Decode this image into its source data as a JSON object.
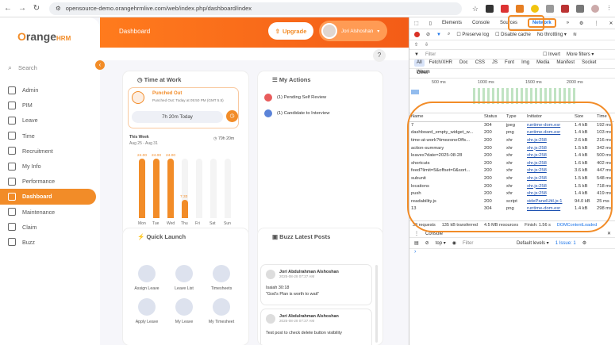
{
  "browser": {
    "url": "opensource-demo.orangehrmlive.com/web/index.php/dashboard/index"
  },
  "app": {
    "logo": "OrangeHRM",
    "search_placeholder": "Search",
    "page_title": "Dashboard",
    "upgrade_label": "Upgrade",
    "user_name": "Jori Alshoshan",
    "help_label": "?",
    "menu": [
      {
        "label": "Admin",
        "icon": "admin-icon"
      },
      {
        "label": "PIM",
        "icon": "pim-icon"
      },
      {
        "label": "Leave",
        "icon": "leave-icon"
      },
      {
        "label": "Time",
        "icon": "time-icon"
      },
      {
        "label": "Recruitment",
        "icon": "recruitment-icon"
      },
      {
        "label": "My Info",
        "icon": "myinfo-icon"
      },
      {
        "label": "Performance",
        "icon": "performance-icon"
      },
      {
        "label": "Dashboard",
        "icon": "dashboard-icon",
        "active": true
      },
      {
        "label": "Maintenance",
        "icon": "maintenance-icon"
      },
      {
        "label": "Claim",
        "icon": "claim-icon"
      },
      {
        "label": "Buzz",
        "icon": "buzz-icon"
      }
    ],
    "time_at_work": {
      "title": "Time at Work",
      "status": "Punched Out",
      "punched_out": "Punched Out: Today at 05:50 PM (GMT 5.5)",
      "today": "7h 20m Today",
      "week_label": "This Week",
      "week_range": "Aug 25 - Aug 31",
      "week_total": "79h 20m",
      "bars": [
        {
          "day": "Mon",
          "value": 24.0,
          "label": "24.00"
        },
        {
          "day": "Tue",
          "value": 24.0,
          "label": "24.00"
        },
        {
          "day": "Wed",
          "value": 24.0,
          "label": "24.00"
        },
        {
          "day": "Thu",
          "value": 7.33,
          "label": "7.33"
        },
        {
          "day": "Fri",
          "value": 0,
          "label": ""
        },
        {
          "day": "Sat",
          "value": 0,
          "label": ""
        },
        {
          "day": "Sun",
          "value": 0,
          "label": ""
        }
      ]
    },
    "my_actions": {
      "title": "My Actions",
      "items": [
        "(1) Pending Self Review",
        "(1) Candidate to Interview"
      ]
    },
    "quick_launch": {
      "title": "Quick Launch",
      "items": [
        "Assign Leave",
        "Leave List",
        "Timesheets",
        "Apply Leave",
        "My Leave",
        "My Timesheet"
      ]
    },
    "buzz": {
      "title": "Buzz Latest Posts",
      "posts": [
        {
          "author": "Jori Abdulrahman Alshoshan",
          "date": "2025-08-28 07:37 AM",
          "text": "Isaiah 30:18\n\"God's Plan is worth to wait\""
        },
        {
          "author": "Jori Abdulrahman Alshoshan",
          "date": "2025-08-28 07:37 AM",
          "text": "Test post to check delete button visibility"
        }
      ]
    }
  },
  "devtools": {
    "tabs": [
      "Elements",
      "Console",
      "Sources",
      "Network"
    ],
    "active_tab": "Network",
    "preserve_log": "Preserve log",
    "disable_cache": "Disable cache",
    "throttle": "No throttling",
    "filter_placeholder": "Filter",
    "invert": "Invert",
    "more_filters": "More filters",
    "types": [
      "All",
      "Fetch/XHR",
      "Doc",
      "CSS",
      "JS",
      "Font",
      "Img",
      "Media",
      "Manifest",
      "Socket",
      "Wasm",
      "Other"
    ],
    "timeline": [
      "500 ms",
      "1000 ms",
      "1500 ms",
      "2000 ms"
    ],
    "columns": [
      "Name",
      "Status",
      "Type",
      "Initiator",
      "Size",
      "Time"
    ],
    "rows": [
      [
        "7",
        "304",
        "jpeg",
        "runtime-dom.esr",
        "1.4 kB",
        "192 ms"
      ],
      [
        "dashboard_empty_widget_w...",
        "200",
        "png",
        "runtime-dom.esr",
        "1.4 kB",
        "103 ms"
      ],
      [
        "time-at-work?timezoneOffs...",
        "200",
        "xhr",
        "xhr.js:258",
        "2.6 kB",
        "216 ms"
      ],
      [
        "action-summary",
        "200",
        "xhr",
        "xhr.js:258",
        "1.5 kB",
        "342 ms"
      ],
      [
        "leaves?date=2025-08-28",
        "200",
        "xhr",
        "xhr.js:258",
        "1.4 kB",
        "500 ms"
      ],
      [
        "shortcuts",
        "200",
        "xhr",
        "xhr.js:258",
        "1.6 kB",
        "402 ms"
      ],
      [
        "feed?limit=5&offset=0&sort...",
        "200",
        "xhr",
        "xhr.js:258",
        "3.6 kB",
        "447 ms"
      ],
      [
        "subunit",
        "200",
        "xhr",
        "xhr.js:258",
        "1.5 kB",
        "548 ms"
      ],
      [
        "locations",
        "200",
        "xhr",
        "xhr.js:258",
        "1.5 kB",
        "718 ms"
      ],
      [
        "push",
        "200",
        "xhr",
        "xhr.js:258",
        "1.4 kB",
        "419 ms"
      ],
      [
        "readability.js",
        "200",
        "script",
        "sidePanelUtil.js:1",
        "94.0 kB",
        "25 ms"
      ],
      [
        "13",
        "304",
        "png",
        "runtime-dom.esr",
        "1.4 kB",
        "298 ms"
      ]
    ],
    "summary": [
      "33 requests",
      "135 kB transferred",
      "4.5 MB resources",
      "Finish: 1.56 s",
      "DOMContentLoaded"
    ],
    "console_context": "top",
    "console_filter": "Filter",
    "default_levels": "Default levels",
    "issue": "1 Issue: 1"
  }
}
